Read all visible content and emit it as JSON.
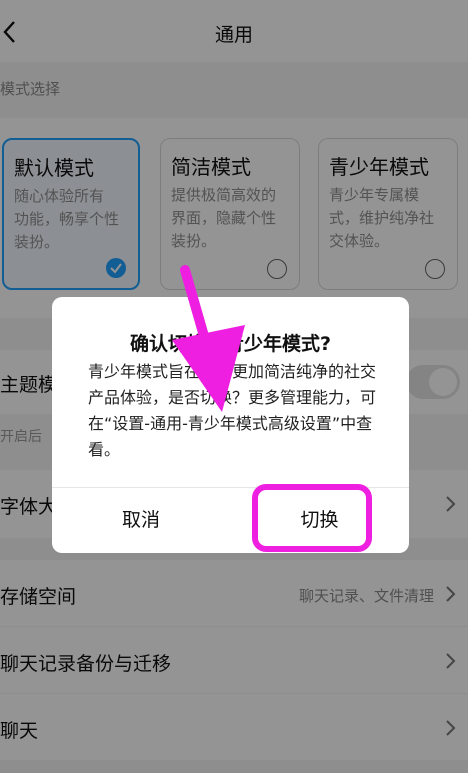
{
  "header": {
    "title": "通用",
    "back_icon": "chevron-left-icon"
  },
  "mode_section": {
    "label": "模式选择",
    "options": [
      {
        "title": "默认模式",
        "desc": [
          "随心体验所有",
          "功能，畅享个性",
          "装扮。"
        ],
        "selected": true
      },
      {
        "title": "简洁模式",
        "desc": [
          "提供极简高效的",
          "界面，隐藏个性",
          "装扮。"
        ],
        "selected": false
      },
      {
        "title": "青少年模式",
        "desc": [
          "青少年专属模",
          "式，维护纯净社",
          "交体验。"
        ],
        "selected": false
      }
    ]
  },
  "settings": {
    "theme_label": "主题模",
    "theme_hint": "开启后",
    "font_label": "字体大",
    "storage_label": "存储空间",
    "storage_value": "聊天记录、文件清理",
    "backup_label": "聊天记录备份与迁移",
    "chat_label": "聊天"
  },
  "dialog": {
    "title": "确认切换到青少年模式?",
    "body": "青少年模式旨在提供更加简洁纯净的社交产品体验，是否切换？更多管理能力，可在“设置-通用-青少年模式高级设置”中查看。",
    "cancel_label": "取消",
    "confirm_label": "切换"
  },
  "colors": {
    "accent": "#1ea0ff",
    "annotation": "#ee1fe0"
  }
}
